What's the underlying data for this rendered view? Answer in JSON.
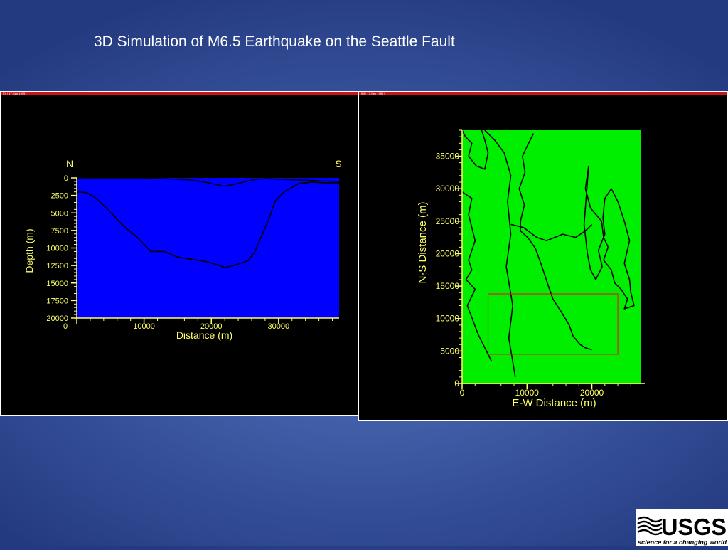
{
  "slide": {
    "title": "3D Simulation of M6.5 Earthquake on the Seattle Fault"
  },
  "colors": {
    "background": "#3d5aa3",
    "plot_blue": "#0000ff",
    "plot_green": "#00ee00",
    "axis_yellow": "#ffff66",
    "header_red": "#c8141b",
    "outline_red": "#e02020"
  },
  "panels": [
    {
      "header": "[D] | 17-Sep 1995 |"
    },
    {
      "header": "[D] | 17-Sep 1995 |"
    }
  ],
  "logo": {
    "text": "USGS",
    "tagline": "science for a changing world",
    "icon": "usgs-wave-icon"
  },
  "chart_data": [
    {
      "type": "area",
      "xlabel": "Distance (m)",
      "ylabel": "Depth (m)",
      "xlim": [
        0,
        39000
      ],
      "ylim": [
        0,
        20000
      ],
      "y_inverted": true,
      "xticks": [
        0,
        10000,
        20000,
        30000
      ],
      "yticks": [
        0,
        2500,
        5000,
        7500,
        10000,
        12500,
        15000,
        17500,
        20000
      ],
      "annotations": {
        "left": "N",
        "right": "S"
      },
      "fill": "#0000ff",
      "series": [
        {
          "x": [
            0,
            1500,
            3000,
            5000,
            7000,
            9000,
            11000,
            13000,
            15000,
            17000,
            19000,
            21000,
            22000,
            24000,
            25500,
            26500,
            27500,
            28500,
            29500,
            31000,
            33000,
            35000,
            37000,
            39000
          ],
          "y": [
            2000,
            2100,
            3000,
            4900,
            6900,
            8500,
            10500,
            10500,
            11300,
            11600,
            11900,
            12400,
            12800,
            12300,
            11800,
            10500,
            8200,
            6000,
            3300,
            1900,
            800,
            600,
            700,
            700
          ]
        },
        {
          "x": [
            0,
            5000,
            10000,
            15000,
            17000,
            19000,
            20500,
            22000,
            24000,
            26000,
            28000,
            30000,
            33000,
            36000,
            39000
          ],
          "y": [
            0,
            0,
            0,
            200,
            300,
            600,
            900,
            1200,
            800,
            300,
            100,
            200,
            300,
            400,
            500
          ]
        }
      ]
    },
    {
      "type": "map",
      "xlabel": "E-W Distance (m)",
      "ylabel": "N-S Distance (m)",
      "xlim": [
        0,
        27500
      ],
      "ylim": [
        0,
        39000
      ],
      "xticks": [
        0,
        10000,
        20000
      ],
      "yticks": [
        0,
        5000,
        10000,
        15000,
        20000,
        25000,
        30000,
        35000
      ],
      "fill": "#00ee00",
      "outlines": [
        {
          "x": [
            0,
            500,
            1500,
            1000,
            2200,
            3500,
            4000,
            3500,
            3000
          ],
          "y": [
            39000,
            38000,
            37000,
            35000,
            33500,
            33000,
            35500,
            37500,
            39000
          ]
        },
        {
          "x": [
            0,
            1500,
            1000,
            2000,
            1000,
            1500,
            600,
            2000,
            800,
            2500,
            4500
          ],
          "y": [
            29500,
            28500,
            26000,
            22000,
            19000,
            17500,
            16000,
            14500,
            12000,
            7500,
            3500
          ]
        },
        {
          "x": [
            11000,
            10000,
            9300,
            9700,
            8800,
            9600,
            9000,
            9000,
            10100,
            11300,
            12200,
            13300,
            14000,
            15300,
            16500,
            17100,
            18200,
            19000,
            20000
          ],
          "y": [
            38500,
            36500,
            35000,
            32500,
            30000,
            27500,
            25000,
            23500,
            22500,
            20800,
            18300,
            15000,
            13000,
            11000,
            9000,
            7300,
            6000,
            5500,
            5200
          ]
        },
        {
          "x": [
            7500,
            9500,
            11500,
            13000,
            15500,
            17500,
            19000,
            20000
          ],
          "y": [
            24500,
            24000,
            22500,
            22000,
            23000,
            22500,
            23500,
            24500
          ]
        },
        {
          "x": [
            19500,
            19000,
            19800,
            21500,
            21800,
            22500,
            21800,
            23000,
            23500,
            24500,
            25500,
            25000,
            26500,
            26000,
            25800,
            25000,
            25800,
            25000,
            24000,
            23000,
            22000,
            21700,
            22000,
            21000,
            21600,
            20600,
            19800,
            19300,
            18800,
            19500
          ],
          "y": [
            33500,
            30000,
            27000,
            25000,
            22500,
            21000,
            19000,
            17500,
            15500,
            14500,
            13000,
            11500,
            12000,
            14000,
            16000,
            18500,
            22000,
            25000,
            28000,
            30000,
            28500,
            25500,
            23000,
            20500,
            18000,
            16000,
            17500,
            20000,
            24500,
            33500
          ]
        },
        {
          "x": [
            3500,
            5000,
            6500,
            7500,
            7000,
            7500,
            6800,
            7800,
            7200,
            8200
          ],
          "y": [
            39000,
            37500,
            35500,
            32000,
            28000,
            23000,
            18000,
            12000,
            7000,
            1000
          ]
        }
      ],
      "box": {
        "x": [
          4000,
          24000
        ],
        "y": [
          4500,
          13800
        ],
        "color": "#e02020"
      }
    }
  ]
}
